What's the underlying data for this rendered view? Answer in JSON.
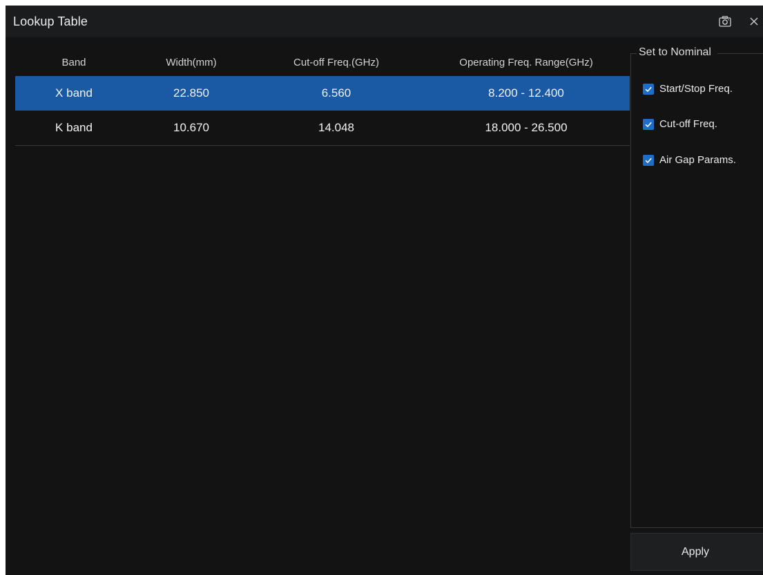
{
  "window": {
    "title": "Lookup Table",
    "screenshot_icon": "camera-icon",
    "close_icon": "close-icon"
  },
  "table": {
    "headers": [
      "Band",
      "Width(mm)",
      "Cut-off Freq.(GHz)",
      "Operating Freq. Range(GHz)"
    ],
    "rows": [
      {
        "band": "X band",
        "width": "22.850",
        "cutoff": "6.560",
        "range": "8.200 - 12.400",
        "selected": true
      },
      {
        "band": "K band",
        "width": "10.670",
        "cutoff": "14.048",
        "range": "18.000 - 26.500",
        "selected": false
      }
    ]
  },
  "nominal": {
    "title": "Set to Nominal",
    "options": [
      {
        "label": "Start/Stop Freq.",
        "checked": true
      },
      {
        "label": "Cut-off Freq.",
        "checked": true
      },
      {
        "label": "Air Gap Params.",
        "checked": true
      }
    ]
  },
  "actions": {
    "apply_label": "Apply"
  },
  "colors": {
    "background": "#131313",
    "titlebar": "#1b1c1e",
    "selection": "#1a5aa5",
    "checkbox": "#1e6ec8"
  }
}
